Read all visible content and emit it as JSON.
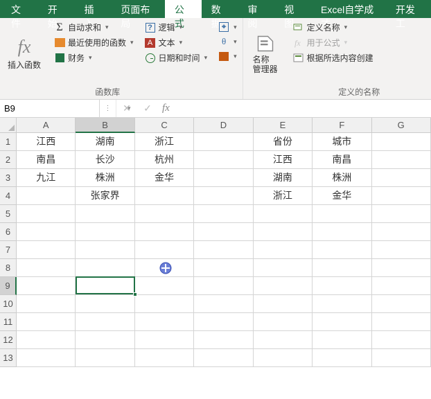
{
  "tabs": {
    "file": "文件",
    "home": "开始",
    "insert": "插入",
    "pagelayout": "页面布局",
    "formulas": "公式",
    "data": "数据",
    "review": "审阅",
    "view": "视图",
    "addin": "Excel自学成才",
    "dev": "开发工"
  },
  "ribbon": {
    "insert_fn": "插入函数",
    "autosum": "自动求和",
    "recent": "最近使用的函数",
    "financial": "财务",
    "logical": "逻辑",
    "text": "文本",
    "datetime": "日期和时间",
    "lib_label": "函数库",
    "name_mgr": "名称\n管理器",
    "define_name": "定义名称",
    "use_in_formula": "用于公式",
    "create_from_sel": "根据所选内容创建",
    "defined_names_label": "定义的名称"
  },
  "namebox": "B9",
  "formula": "",
  "columns": [
    "A",
    "B",
    "C",
    "D",
    "E",
    "F",
    "G"
  ],
  "row_count": 13,
  "active_col_index": 1,
  "active_row_index": 8,
  "cells": {
    "r1": {
      "A": "江西",
      "B": "湖南",
      "C": "浙江",
      "E": "省份",
      "F": "城市"
    },
    "r2": {
      "A": "南昌",
      "B": "长沙",
      "C": "杭州",
      "E": "江西",
      "F": "南昌"
    },
    "r3": {
      "A": "九江",
      "B": "株洲",
      "C": "金华",
      "E": "湖南",
      "F": "株洲"
    },
    "r4": {
      "B": "张家界",
      "E": "浙江",
      "F": "金华"
    }
  },
  "cursor_pos": {
    "col": 2,
    "row": 7
  }
}
